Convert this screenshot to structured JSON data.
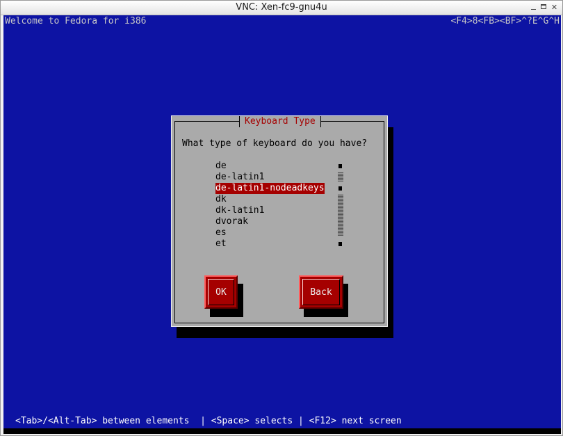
{
  "window": {
    "title": "VNC: Xen-fc9-gnu4u"
  },
  "console": {
    "welcome": "Welcome to Fedora for i386",
    "hotkeys": "<F4>8<FB><BF>^?E^G^H"
  },
  "dialog": {
    "title": "Keyboard Type",
    "question": "What type of keyboard do you have?",
    "items": [
      {
        "label": "de",
        "selected": false
      },
      {
        "label": "de-latin1",
        "selected": false
      },
      {
        "label": "de-latin1-nodeadkeys",
        "selected": true
      },
      {
        "label": "dk",
        "selected": false
      },
      {
        "label": "dk-latin1",
        "selected": false
      },
      {
        "label": "dvorak",
        "selected": false
      },
      {
        "label": "es",
        "selected": false
      },
      {
        "label": "et",
        "selected": false
      }
    ],
    "ok_label": "OK",
    "back_label": "Back"
  },
  "help_line": "<Tab>/<Alt-Tab> between elements  | <Space> selects | <F12> next screen",
  "colors": {
    "screen_bg": "#0d13a3",
    "dialog_bg": "#aaaaaa",
    "accent": "#a50000"
  }
}
